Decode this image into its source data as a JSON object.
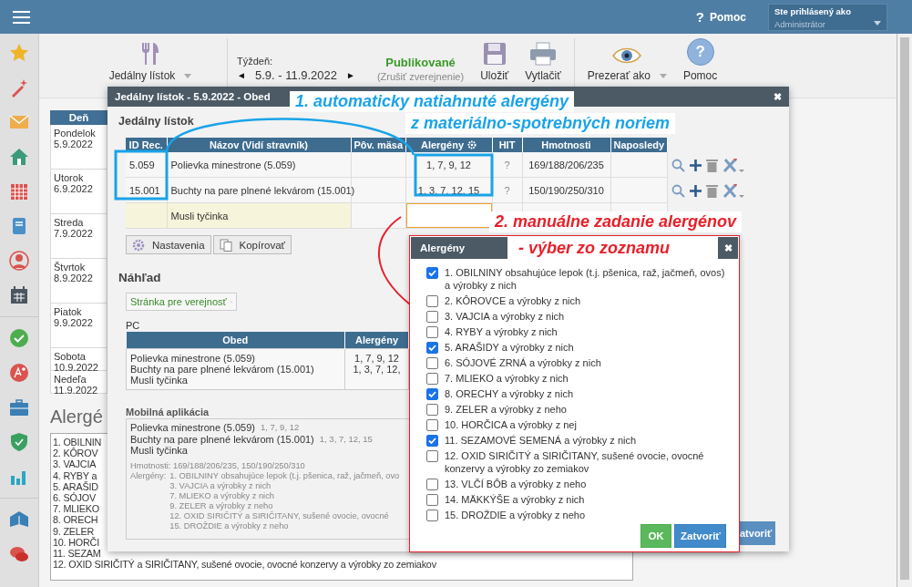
{
  "top_bar": {
    "help_icon": "?",
    "help": "Pomoc",
    "user_label": "Ste prihlásený ako",
    "user_value": "Administrátor"
  },
  "toolbar": {
    "menu": "Jedálny lístok",
    "week_label": "Týždeň:",
    "prev": "◄",
    "week": "5.9. - 11.9.2022",
    "next": "►",
    "status": "Publikované",
    "unpublish": "(Zrušiť zverejnenie)",
    "save": "Uložiť",
    "print": "Vytlačiť",
    "view_as": "Prezerať ako",
    "help_icon": "?",
    "help": "Pomoc"
  },
  "days_header": "Deň",
  "days": [
    {
      "name": "Pondelok",
      "date": "5.9.2022"
    },
    {
      "name": "Utorok",
      "date": "6.9.2022"
    },
    {
      "name": "Streda",
      "date": "7.9.2022"
    },
    {
      "name": "Štvrtok",
      "date": "8.9.2022"
    },
    {
      "name": "Piatok",
      "date": "9.9.2022"
    },
    {
      "name": "Sobota",
      "date": "10.9.2022"
    },
    {
      "name": "Nedeľa",
      "date": "11.9.2022"
    }
  ],
  "allergen_heading": "Alergé",
  "allergen_lines": [
    "1. OBILNIN",
    "2. KÔROV",
    "3. VAJCIA",
    "4. RYBY a",
    "5. ARAŠID",
    "6. SÓJOV",
    "7. MLIEKO",
    "8. ORECH",
    "9. ZELER",
    "10. HORČI",
    "11. SEZAM",
    "12. OXID SIRIČITÝ a SIRIČITANY, sušené ovocie, ovocné konzervy a výrobky zo zemiakov"
  ],
  "dialog": {
    "title": "Jedálny lístok - 5.9.2022 - Obed",
    "close": "✖",
    "section": "Jedálny lístok",
    "columns": [
      "ID Rec.",
      "Názov (Vidí stravník)",
      "Pôv. mäsa",
      "Alergény",
      "HIT",
      "Hmotnosti",
      "Naposledy"
    ],
    "rows": [
      {
        "id": "5.059",
        "name": "Polievka minestrone (5.059)",
        "allergens": "1, 7, 9, 12",
        "hit": "?",
        "weights": "169/188/206/235",
        "editing": false
      },
      {
        "id": "15.001",
        "name": "Buchty na pare plnené lekvárom (15.001)",
        "allergens": "1, 3, 7, 12, 15",
        "hit": "?",
        "weights": "150/190/250/310",
        "editing": false
      },
      {
        "name": "Musli tyčinka",
        "editing": true
      }
    ],
    "settings": "Nastavenia",
    "copy": "Kopírovať",
    "preview": "Náhľad",
    "audience": "Stránka pre verejnosť",
    "pc_label": "PC",
    "pc_columns": [
      "Obed",
      "Alergény"
    ],
    "pc_rows": [
      {
        "name": "Polievka minestrone (5.059)",
        "allergens": "1, 7, 9, 12"
      },
      {
        "name": "Buchty na pare plnené lekvárom (15.001)",
        "allergens": "1, 3, 7, 12,"
      },
      {
        "name": "Musli tyčinka"
      }
    ],
    "mobile_label": "Mobilná aplikácia",
    "mobile_rows": [
      {
        "name": "Polievka minestrone (5.059)",
        "allergens": "1, 7, 9, 12"
      },
      {
        "name": "Buchty na pare plnené lekvárom (15.001)",
        "allergens": "1, 3, 7, 12, 15"
      },
      {
        "name": "Musli tyčinka"
      }
    ],
    "weights": "Hmotnosti: 169/188/206/235, 150/190/250/310",
    "mobile_allergen_label": "Alergény:",
    "mobile_allergens": [
      "1. OBILNINY obsahujúce lepok (t.j. pšenica, raž, jačmeň, ovo",
      "3. VAJCIA a výrobky z nich",
      "7. MLIEKO a výrobky z nich",
      "9. ZELER a výrobky z neho",
      "12. OXID SIRIČITÝ a SIRIČITANY, sušené ovocie, ovocné",
      "15. DROŽDIE a výrobky z neho"
    ],
    "close_button": "atvoriť"
  },
  "allergen_dialog": {
    "title": "Alergény",
    "close": "✖",
    "items": [
      {
        "label": "1. OBILNINY obsahujúce lepok (t.j. pšenica, raž, jačmeň, ovos) a výrobky z nich",
        "checked": true
      },
      {
        "label": "2. KÔROVCE a výrobky z nich",
        "checked": false
      },
      {
        "label": "3. VAJCIA a výrobky z nich",
        "checked": false
      },
      {
        "label": "4. RYBY a výrobky z nich",
        "checked": false
      },
      {
        "label": "5. ARAŠIDY a výrobky z nich",
        "checked": true
      },
      {
        "label": "6. SÓJOVÉ ZRNÁ a výrobky z nich",
        "checked": false
      },
      {
        "label": "7. MLIEKO a výrobky z nich",
        "checked": false
      },
      {
        "label": "8. ORECHY a výrobky z nich",
        "checked": true
      },
      {
        "label": "9. ZELER a výrobky z neho",
        "checked": false
      },
      {
        "label": "10. HORČICA a výrobky z nej",
        "checked": false
      },
      {
        "label": "11. SEZAMOVÉ SEMENÁ a výrobky z nich",
        "checked": true
      },
      {
        "label": "12. OXID SIRIČITÝ a SIRIČITANY, sušené ovocie, ovocné konzervy a výrobky zo zemiakov",
        "checked": false
      },
      {
        "label": "13. VLČÍ BÔB a výrobky z neho",
        "checked": false
      },
      {
        "label": "14. MÄKKÝŠE a výrobky z nich",
        "checked": false
      },
      {
        "label": "15. DROŽDIE a výrobky z neho",
        "checked": false
      }
    ],
    "ok": "OK",
    "cancel": "Zatvoriť"
  },
  "annotations": {
    "auto": [
      "1. automaticky natiahnuté alergény",
      "z materiálno-spotrebných noriem"
    ],
    "manual": [
      "2. manuálne zadanie alergénov",
      "- výber zo zoznamu"
    ]
  }
}
